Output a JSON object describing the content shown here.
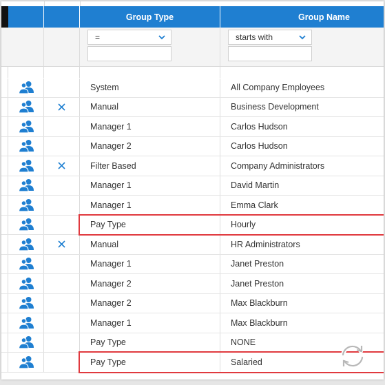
{
  "columns": {
    "group_type": "Group Type",
    "group_name": "Group Name"
  },
  "filters": {
    "group_type_operator": "=",
    "group_name_operator": "starts with",
    "group_type_value": "",
    "group_name_value": ""
  },
  "rows": [
    {
      "type": "System",
      "name": "All Company Employees",
      "removable": false
    },
    {
      "type": "Manual",
      "name": "Business Development",
      "removable": true
    },
    {
      "type": "Manager 1",
      "name": "Carlos Hudson",
      "removable": false
    },
    {
      "type": "Manager 2",
      "name": "Carlos Hudson",
      "removable": false
    },
    {
      "type": "Filter Based",
      "name": "Company Administrators",
      "removable": true
    },
    {
      "type": "Manager 1",
      "name": "David Martin",
      "removable": false
    },
    {
      "type": "Manager 1",
      "name": "Emma Clark",
      "removable": false
    },
    {
      "type": "Pay Type",
      "name": "Hourly",
      "removable": false,
      "highlighted": true
    },
    {
      "type": "Manual",
      "name": "HR Administrators",
      "removable": true
    },
    {
      "type": "Manager 1",
      "name": "Janet Preston",
      "removable": false
    },
    {
      "type": "Manager 2",
      "name": "Janet Preston",
      "removable": false
    },
    {
      "type": "Manager 2",
      "name": "Max Blackburn",
      "removable": false
    },
    {
      "type": "Manager 1",
      "name": "Max Blackburn",
      "removable": false
    },
    {
      "type": "Pay Type",
      "name": "NONE",
      "removable": false
    },
    {
      "type": "Pay Type",
      "name": "Salaried",
      "removable": false,
      "highlighted": true
    }
  ],
  "colors": {
    "header_bg": "#1f7fd1",
    "icon_blue": "#1f7fd1",
    "highlight_red": "#e0393e"
  },
  "icons": {
    "members": "users-icon",
    "remove": "close-icon",
    "dropdown": "chevron-down-icon",
    "refresh": "refresh-icon"
  }
}
